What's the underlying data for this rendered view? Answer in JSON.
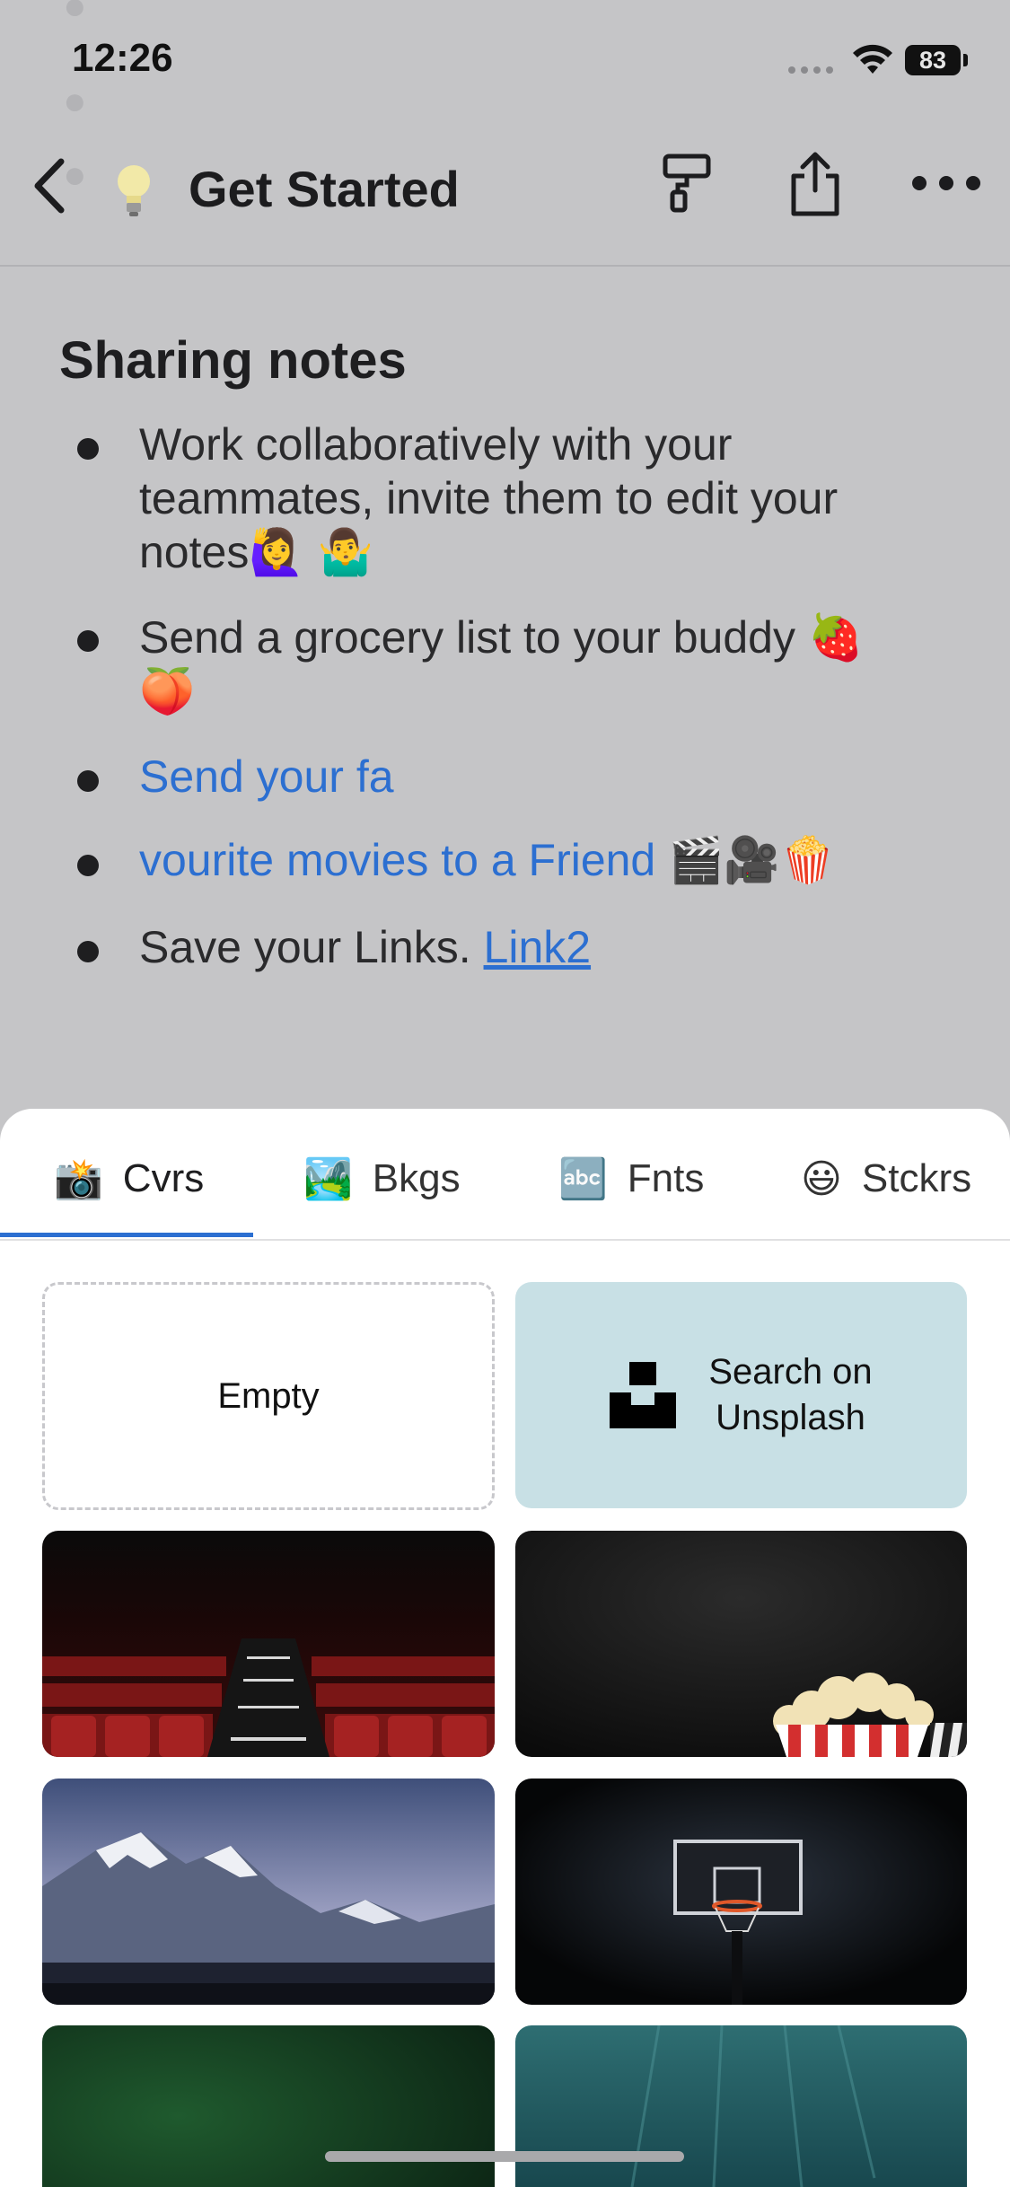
{
  "status_bar": {
    "time": "12:26",
    "battery": "83"
  },
  "nav": {
    "title": "Get Started",
    "back_icon": "chevron-left-icon",
    "format_icon": "paint-roller-icon",
    "share_icon": "share-icon",
    "more_icon": "ellipsis-icon"
  },
  "note": {
    "heading": "Sharing notes",
    "items": [
      {
        "lines": [
          "Work collaboratively with your",
          "teammates, invite them to edit your",
          "notes🙋‍♀️ 🤷‍♂️"
        ]
      },
      {
        "lines": [
          "Send a grocery list to your buddy 🍓",
          "🍑"
        ]
      },
      {
        "text": "Send your fa"
      },
      {
        "text": "vourite movies to a Friend 🎬🎥🍿"
      },
      {
        "prefix": "Save your Links. ",
        "link": "Link2"
      }
    ]
  },
  "tabs": [
    {
      "emoji": "📸",
      "label": "Cvrs",
      "selected": true
    },
    {
      "emoji": "🏞️",
      "label": "Bkgs",
      "selected": false
    },
    {
      "emoji": "🔤",
      "label": "Fnts",
      "selected": false
    },
    {
      "emoji": "😃",
      "label": "Stckrs",
      "selected": false
    }
  ],
  "covers": {
    "empty_label": "Empty",
    "unsplash_label": "Search on Unsplash",
    "unsplash_line1": "Search on",
    "unsplash_line2": "Unsplash",
    "images": [
      "cinema-seats",
      "popcorn",
      "mountains",
      "basketball-hoop",
      "green-gradient",
      "underwater-teal"
    ]
  },
  "colors": {
    "accent": "#2c6fd1",
    "unsplash_bg": "#c8e0e5",
    "overlay": "#c5c5c7"
  }
}
